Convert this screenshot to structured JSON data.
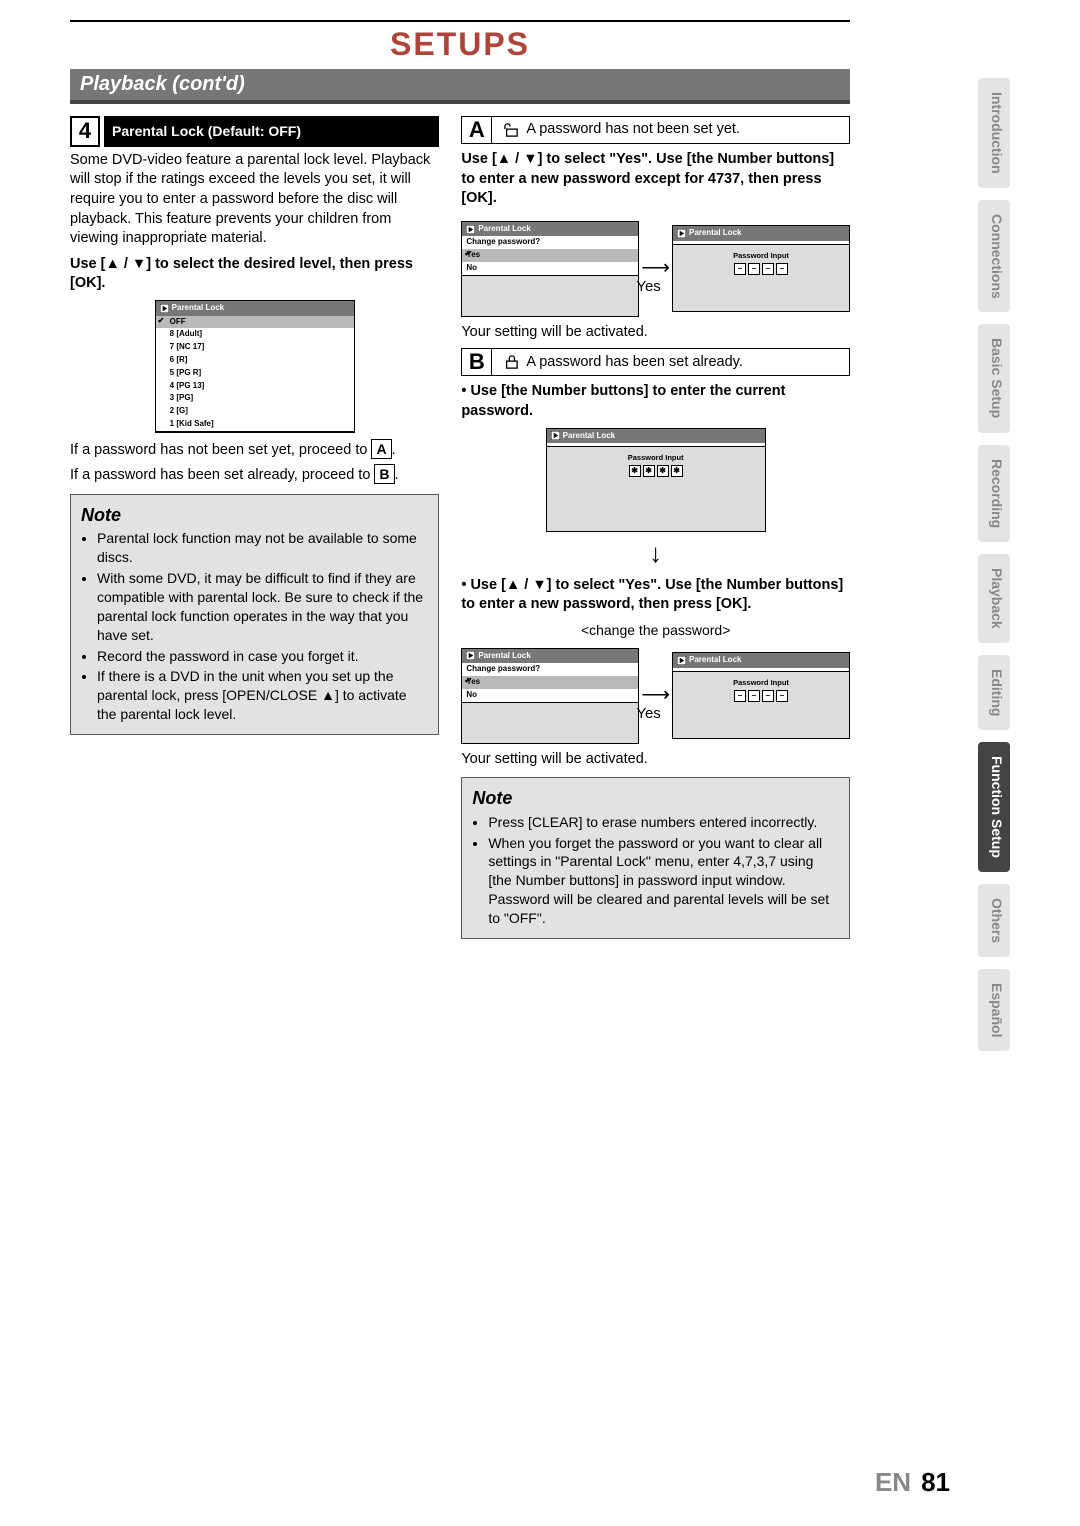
{
  "chapter": "SETUPS",
  "section": "Playback (cont'd)",
  "step4": {
    "num": "4",
    "title": "Parental Lock (Default: OFF)",
    "intro": "Some DVD-video feature a parental lock level. Playback will stop if the ratings exceed the levels you set, it will require you to enter a password before the disc will playback. This feature prevents your children from viewing inappropriate material.",
    "instruction": "Use [▲ / ▼] to select the desired level, then press [OK].",
    "levels_title": "Parental Lock",
    "levels": [
      "OFF",
      "8 [Adult]",
      "7 [NC 17]",
      "6 [R]",
      "5 [PG R]",
      "4 [PG 13]",
      "3 [PG]",
      "2 [G]",
      "1 [Kid Safe]"
    ],
    "branchA_text_pre": "If a password has not been set yet, proceed to ",
    "branchA_box": "A",
    "branchB_text_pre": "If a password has been set already, proceed to ",
    "branchB_box": "B",
    "period": "."
  },
  "note1": {
    "title": "Note",
    "items": [
      "Parental lock function may not be available to some discs.",
      "With some DVD, it may be difficult to find if they are compatible with parental lock. Be sure to check if the parental lock function operates in the way that you have set.",
      "Record the password in case you forget it.",
      "If there is a DVD in the unit when you set up the parental lock, press [OPEN/CLOSE ▲] to activate the parental lock level."
    ]
  },
  "caseA": {
    "box": "A",
    "icon_label": "unlocked-icon",
    "desc": "A password has not been set yet.",
    "instruction": "Use [▲ / ▼] to select \"Yes\". Use [the Number buttons] to enter a new password except for 4737, then press [OK].",
    "left": {
      "title": "Parental Lock",
      "prompt": "Change password?",
      "yes": "Yes",
      "no": "No"
    },
    "right": {
      "title": "Parental Lock",
      "pw_label": "Password Input",
      "cells": [
        "–",
        "–",
        "–",
        "–"
      ]
    },
    "arrow_label": "Yes",
    "after": "Your setting will be activated."
  },
  "caseB": {
    "box": "B",
    "icon_label": "locked-icon",
    "desc": "A password has been set already.",
    "instruction1": "Use [the Number buttons] to enter the current password.",
    "screen1": {
      "title": "Parental Lock",
      "pw_label": "Password Input",
      "cells": [
        "✱",
        "✱",
        "✱",
        "✱"
      ]
    },
    "instruction2": "Use [▲ / ▼] to select \"Yes\". Use [the Number buttons] to enter a new password, then press [OK].",
    "caption": "<change the password>",
    "left": {
      "title": "Parental Lock",
      "prompt": "Change password?",
      "yes": "Yes",
      "no": "No"
    },
    "right": {
      "title": "Parental Lock",
      "pw_label": "Password Input",
      "cells": [
        "–",
        "–",
        "–",
        "–"
      ]
    },
    "arrow_label": "Yes",
    "after": "Your setting will be activated."
  },
  "note2": {
    "title": "Note",
    "items": [
      "Press [CLEAR] to erase numbers entered incorrectly.",
      "When you forget the password or you want to clear all settings in \"Parental Lock\" menu, enter 4,7,3,7 using [the Number buttons] in password input window. Password will be cleared and parental levels will be set to \"OFF\"."
    ]
  },
  "tabs": [
    "Introduction",
    "Connections",
    "Basic Setup",
    "Recording",
    "Playback",
    "Editing",
    "Function Setup",
    "Others",
    "Español"
  ],
  "active_tab": "Function Setup",
  "footer": {
    "lang": "EN",
    "page": "81"
  }
}
